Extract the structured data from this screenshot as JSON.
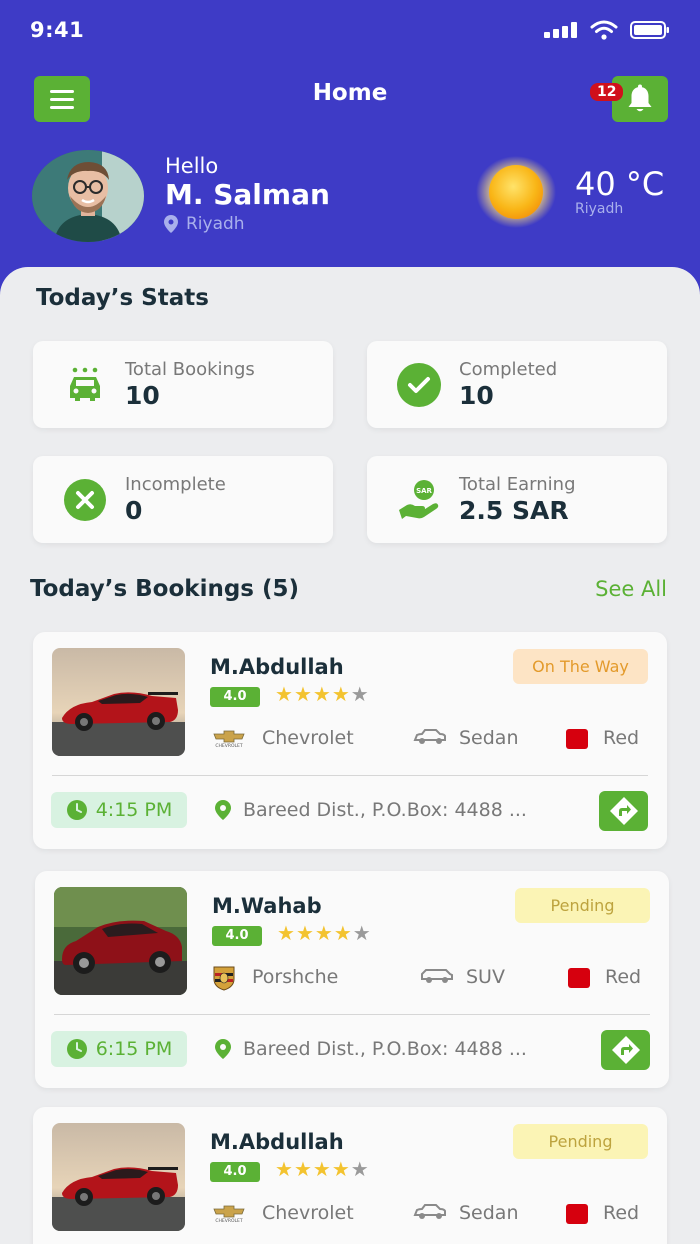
{
  "status_bar": {
    "time": "9:41"
  },
  "header": {
    "title": "Home",
    "notification_count": "12",
    "greeting": "Hello",
    "user_name": "M. Salman",
    "user_location": "Riyadh",
    "temperature": "40 °C",
    "weather_city": "Riyadh"
  },
  "stats": {
    "section_title": "Today’s Stats",
    "items": [
      {
        "label": "Total Bookings",
        "value": "10",
        "icon": "car-front-icon"
      },
      {
        "label": "Completed",
        "value": "10",
        "icon": "check-circle-icon"
      },
      {
        "label": "Incomplete",
        "value": "0",
        "icon": "x-circle-icon"
      },
      {
        "label": "Total Earning",
        "value": "2.5 SAR",
        "icon": "sar-hand-icon"
      }
    ]
  },
  "bookings": {
    "section_title": "Today’s Bookings (5)",
    "see_all": "See All",
    "items": [
      {
        "name": "M.Abdullah",
        "rating": "4.0",
        "stars": 4,
        "status": "On The Way",
        "brand": "Chevrolet",
        "brand_logo": "chevrolet-logo",
        "car_type": "Sedan",
        "color": "Red",
        "time": "4:15 PM",
        "address": "Bareed Dist., P.O.Box: 4488 ..."
      },
      {
        "name": "M.Wahab",
        "rating": "4.0",
        "stars": 4,
        "status": "Pending",
        "brand": "Porshche",
        "brand_logo": "porsche-logo",
        "car_type": "SUV",
        "color": "Red",
        "time": "6:15 PM",
        "address": "Bareed Dist., P.O.Box: 4488 ..."
      },
      {
        "name": "M.Abdullah",
        "rating": "4.0",
        "stars": 4,
        "status": "Pending",
        "brand": "Chevrolet",
        "brand_logo": "chevrolet-logo",
        "car_type": "Sedan",
        "color": "Red"
      }
    ]
  },
  "colors": {
    "header_bg": "#3E3BC6",
    "accent_green": "#5BB135",
    "badge_red": "#D0101B",
    "status_on_the_way_bg": "#FDE4C5",
    "status_pending_bg": "#FBF4B5",
    "car_color_red": "#D6000E"
  }
}
